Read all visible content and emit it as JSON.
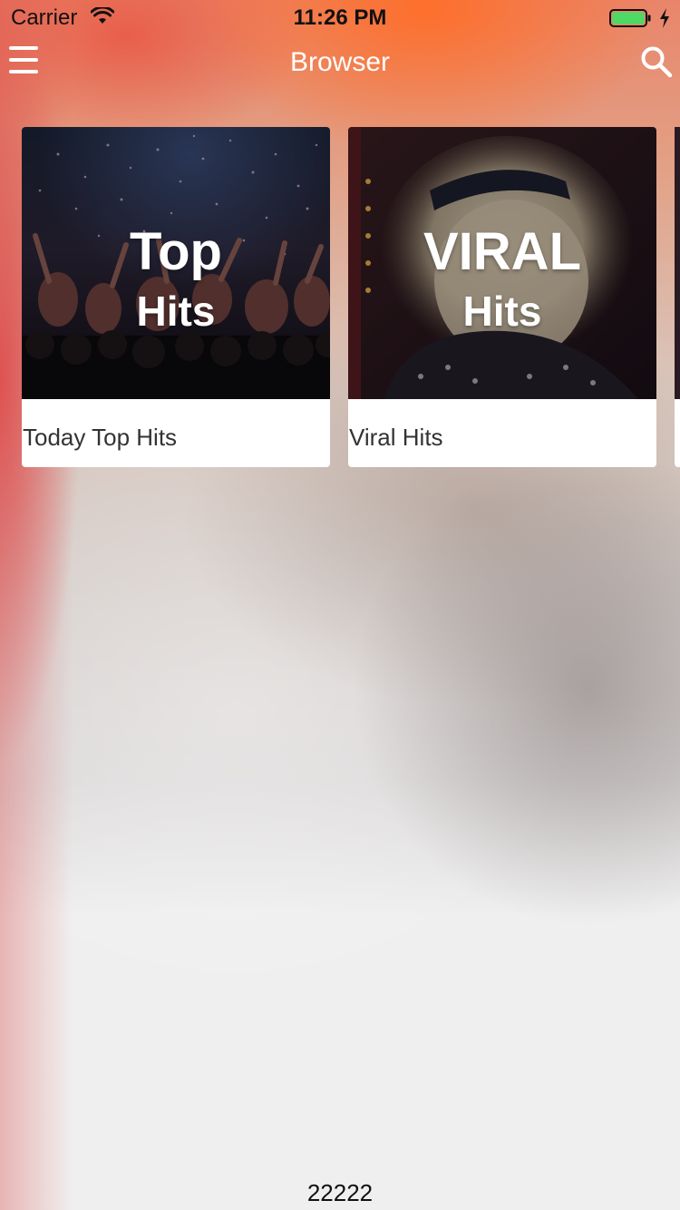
{
  "status_bar": {
    "carrier": "Carrier",
    "time": "11:26 PM",
    "battery_color": "#4cd964"
  },
  "nav": {
    "title": "Browser",
    "menu_icon": "hamburger-menu-icon",
    "search_icon": "search-icon",
    "text_color": "#ffffff"
  },
  "cards": [
    {
      "overlay_line1": "Top",
      "overlay_line2": "Hits",
      "label": "Today Top Hits",
      "image": "concert-crowd-confetti"
    },
    {
      "overlay_line1": "VIRAL",
      "overlay_line2": "Hits",
      "label": "Viral Hits",
      "image": "blonde-woman-sweater"
    }
  ],
  "footer": {
    "text": "22222"
  }
}
